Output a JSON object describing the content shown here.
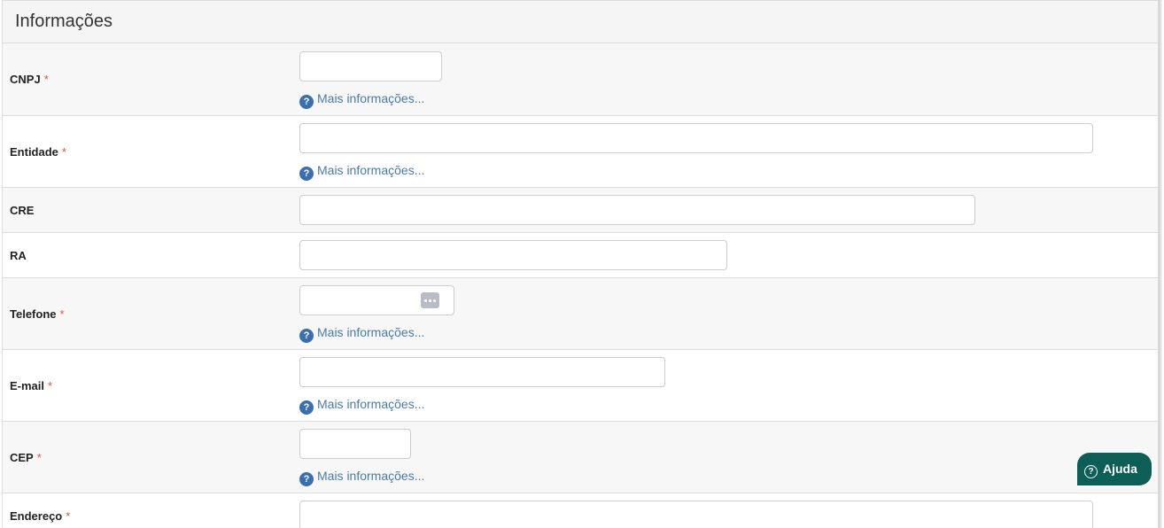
{
  "panel": {
    "title": "Informações"
  },
  "help_link_text": "Mais informações...",
  "required_mark": "*",
  "fields": {
    "cnpj": {
      "label": "CNPJ",
      "value": "",
      "required": true
    },
    "entidade": {
      "label": "Entidade",
      "value": "",
      "required": true
    },
    "cre": {
      "label": "CRE",
      "value": "",
      "required": false
    },
    "ra": {
      "label": "RA",
      "value": "",
      "required": false
    },
    "telefone": {
      "label": "Telefone",
      "value": "",
      "required": true
    },
    "email": {
      "label": "E-mail",
      "value": "",
      "required": true
    },
    "cep": {
      "label": "CEP",
      "value": "",
      "required": true
    },
    "endereco": {
      "label": "Endereço",
      "value": "",
      "required": true
    }
  },
  "help_button": {
    "label": "Ajuda",
    "icon": "question-circle-icon",
    "background": "#0c5e57"
  },
  "colors": {
    "required": "#d9534f",
    "link": "#4a7aa8",
    "help_icon": "#3a6fb0"
  }
}
